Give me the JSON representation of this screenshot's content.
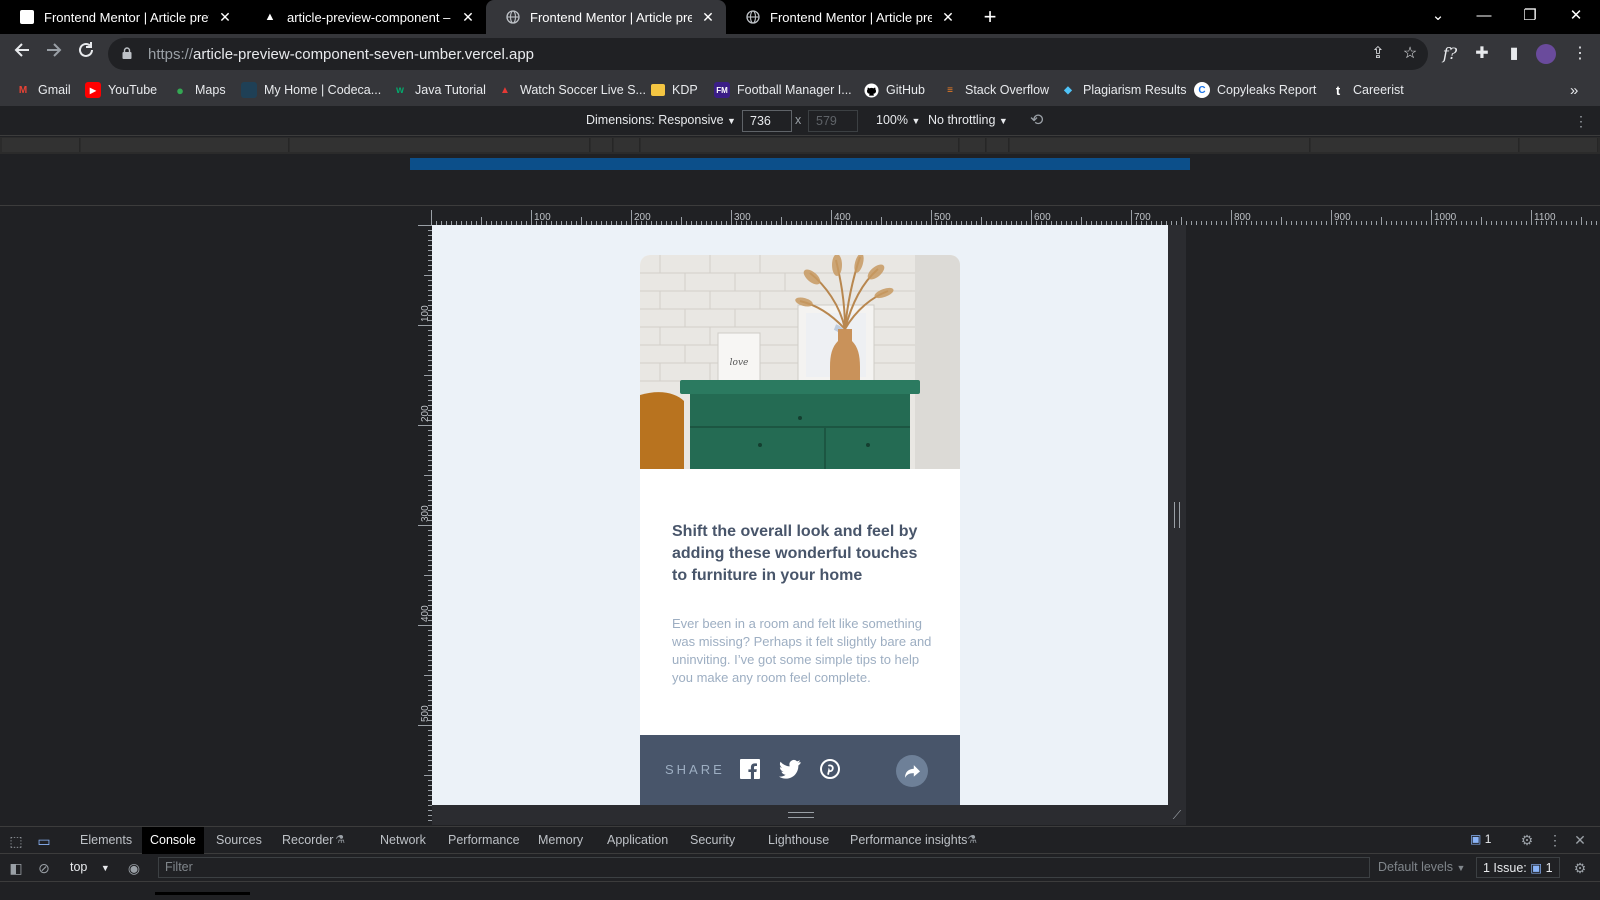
{
  "tabs": [
    {
      "title": "Frontend Mentor | Article previe",
      "favicon": "frontend-mentor-favicon",
      "active": false
    },
    {
      "title": "article-preview-component – Ov",
      "favicon": "vercel-favicon",
      "active": false
    },
    {
      "title": "Frontend Mentor | Article previe",
      "favicon": "globe-favicon",
      "active": true
    },
    {
      "title": "Frontend Mentor | Article previe",
      "favicon": "globe-favicon",
      "active": false
    }
  ],
  "address_bar": {
    "scheme": "https://",
    "host": "article-preview-component-seven-umber.vercel.app"
  },
  "bookmarks": [
    {
      "label": "Gmail",
      "icon": "gmail-icon",
      "color": "#ea4335"
    },
    {
      "label": "YouTube",
      "icon": "youtube-icon",
      "color": "#ff0000"
    },
    {
      "label": "Maps",
      "icon": "maps-icon",
      "color": "#34a853"
    },
    {
      "label": "My Home | Codeca...",
      "icon": "codecademy-icon",
      "color": "#1f4056"
    },
    {
      "label": "Java Tutorial",
      "icon": "w3schools-icon",
      "color": "#04aa6d"
    },
    {
      "label": "Watch Soccer Live S...",
      "icon": "soccer-icon",
      "color": "#e53935"
    },
    {
      "label": "KDP",
      "icon": "folder-icon",
      "color": "#f4c542"
    },
    {
      "label": "Football Manager I...",
      "icon": "fm-icon",
      "color": "#3b1e86"
    },
    {
      "label": "GitHub",
      "icon": "github-icon",
      "color": "#ffffff"
    },
    {
      "label": "Stack Overflow",
      "icon": "stackoverflow-icon",
      "color": "#f48024"
    },
    {
      "label": "Plagiarism Results",
      "icon": "plagiarism-icon",
      "color": "#4fc3f7"
    },
    {
      "label": "Copyleaks Report",
      "icon": "copyleaks-icon",
      "color": "#ffffff"
    },
    {
      "label": "Careerist",
      "icon": "careerist-icon",
      "color": "#ffffff"
    }
  ],
  "device_toolbar": {
    "dimensions_label": "Dimensions: Responsive",
    "width": "736",
    "height": "579",
    "times": "x",
    "zoom": "100%",
    "throttling": "No throttling"
  },
  "ruler": {
    "h_labels": [
      "100",
      "200",
      "300",
      "400",
      "500",
      "600",
      "700",
      "800",
      "900",
      "1000",
      "1100"
    ],
    "v_labels": [
      "100",
      "200",
      "300",
      "400",
      "500"
    ]
  },
  "article": {
    "title": "Shift the overall look and feel by adding these wonderful touches to furniture in your home",
    "body": "Ever been in a room and felt like something was missing? Perhaps it felt slightly bare and uninviting. I’ve got some simple tips to help you make any room feel complete.",
    "share_label": "SHARE",
    "share_icons": [
      "facebook-icon",
      "twitter-icon",
      "pinterest-icon"
    ],
    "colors": {
      "dark_blue": "#48556a",
      "desaturated": "#6e8098",
      "grayish": "#9daec2",
      "light": "#ecf2f8"
    }
  },
  "devtools": {
    "tabs": [
      "Elements",
      "Console",
      "Sources",
      "Recorder",
      "Network",
      "Performance",
      "Memory",
      "Application",
      "Security",
      "Lighthouse",
      "Performance insights"
    ],
    "active_tab": "Console",
    "issues_badge": "1",
    "context": "top",
    "filter_placeholder": "Filter",
    "levels": "Default levels",
    "issues_label": "1 Issue:",
    "issues_count": "1"
  }
}
